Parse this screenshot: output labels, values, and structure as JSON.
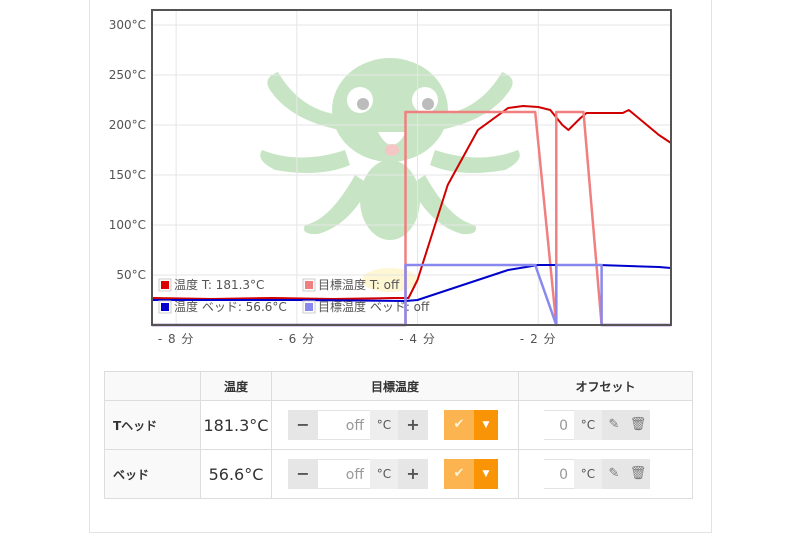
{
  "chart_data": {
    "type": "line",
    "y_tick_labels": [
      "300°C",
      "250°C",
      "200°C",
      "150°C",
      "100°C",
      "50°C"
    ],
    "y_ticks": [
      300,
      250,
      200,
      150,
      100,
      50
    ],
    "x_tick_labels": [
      "- 8 分",
      "- 6 分",
      "- 4 分",
      "- 2 分"
    ],
    "x_ticks": [
      -8,
      -6,
      -4,
      -2
    ],
    "xlim": [
      -8.4,
      0.2
    ],
    "ylim": [
      0,
      315
    ],
    "grid": true,
    "legend_placement": "bottom-left",
    "series": [
      {
        "name": "温度 T: 181.3°C",
        "color": "#d00000",
        "x": [
          -8.4,
          -7.4,
          -6.4,
          -5.4,
          -4.4,
          -4.15,
          -4.0,
          -3.5,
          -3.0,
          -2.5,
          -2.25,
          -2.0,
          -1.8,
          -1.6,
          -1.5,
          -1.3,
          -1.2,
          -1.0,
          -0.6,
          -0.5,
          -0.2,
          0.0,
          0.2
        ],
        "y": [
          27,
          26,
          27,
          26,
          27,
          27,
          45,
          140,
          195,
          217,
          219,
          218,
          215,
          200,
          195,
          207,
          212,
          212,
          212,
          215,
          200,
          190,
          182
        ]
      },
      {
        "name": "目標温度 T: off",
        "color": "#f08080",
        "x": [
          -8.4,
          -4.2,
          -4.2,
          -2.05,
          -1.7,
          -1.7,
          -1.25,
          -1.25,
          -0.95,
          -0.95,
          0.2
        ],
        "y": [
          0,
          0,
          213,
          213,
          0,
          213,
          213,
          213,
          0,
          0,
          0
        ]
      },
      {
        "name": "温度 ベッド: 56.6°C",
        "color": "#0000cc",
        "x": [
          -8.4,
          -6.0,
          -4.2,
          -4.0,
          -3.5,
          -2.5,
          -2.0,
          -1.0,
          0.0,
          0.2
        ],
        "y": [
          25,
          25,
          24,
          25,
          35,
          55,
          60,
          60,
          58,
          57
        ]
      },
      {
        "name": "目標温度 ベッド: off",
        "color": "#8888ee",
        "x": [
          -8.4,
          -4.2,
          -4.2,
          -2.05,
          -1.7,
          -1.7,
          -0.95,
          -0.95,
          0.2
        ],
        "y": [
          0,
          0,
          60,
          60,
          0,
          60,
          60,
          0,
          0
        ]
      }
    ]
  },
  "legend": [
    {
      "label": "温度 T: 181.3°C",
      "color": "#dd0000"
    },
    {
      "label": "目標温度 T: off",
      "color": "#f08080"
    },
    {
      "label": "温度 ベッド: 56.6°C",
      "color": "#0000cc"
    },
    {
      "label": "目標温度 ベッド: off",
      "color": "#8888ee"
    }
  ],
  "table": {
    "headers": [
      "",
      "温度",
      "目標温度",
      "オフセット"
    ],
    "rows": [
      {
        "name": "Tヘッド",
        "actual": "181.3°C",
        "target": "off",
        "target_unit": "°C",
        "offset": "0",
        "offset_unit": "°C"
      },
      {
        "name": "ベッド",
        "actual": "56.6°C",
        "target": "off",
        "target_unit": "°C",
        "offset": "0",
        "offset_unit": "°C"
      }
    ],
    "minus_label": "−",
    "plus_label": "+",
    "ok_label": "✔",
    "dropdown_label": "▼"
  },
  "icons": [
    "octoprint-logo-watermark",
    "minus-icon",
    "plus-icon",
    "check-icon",
    "caret-down-icon",
    "pencil-icon",
    "trash-icon"
  ]
}
